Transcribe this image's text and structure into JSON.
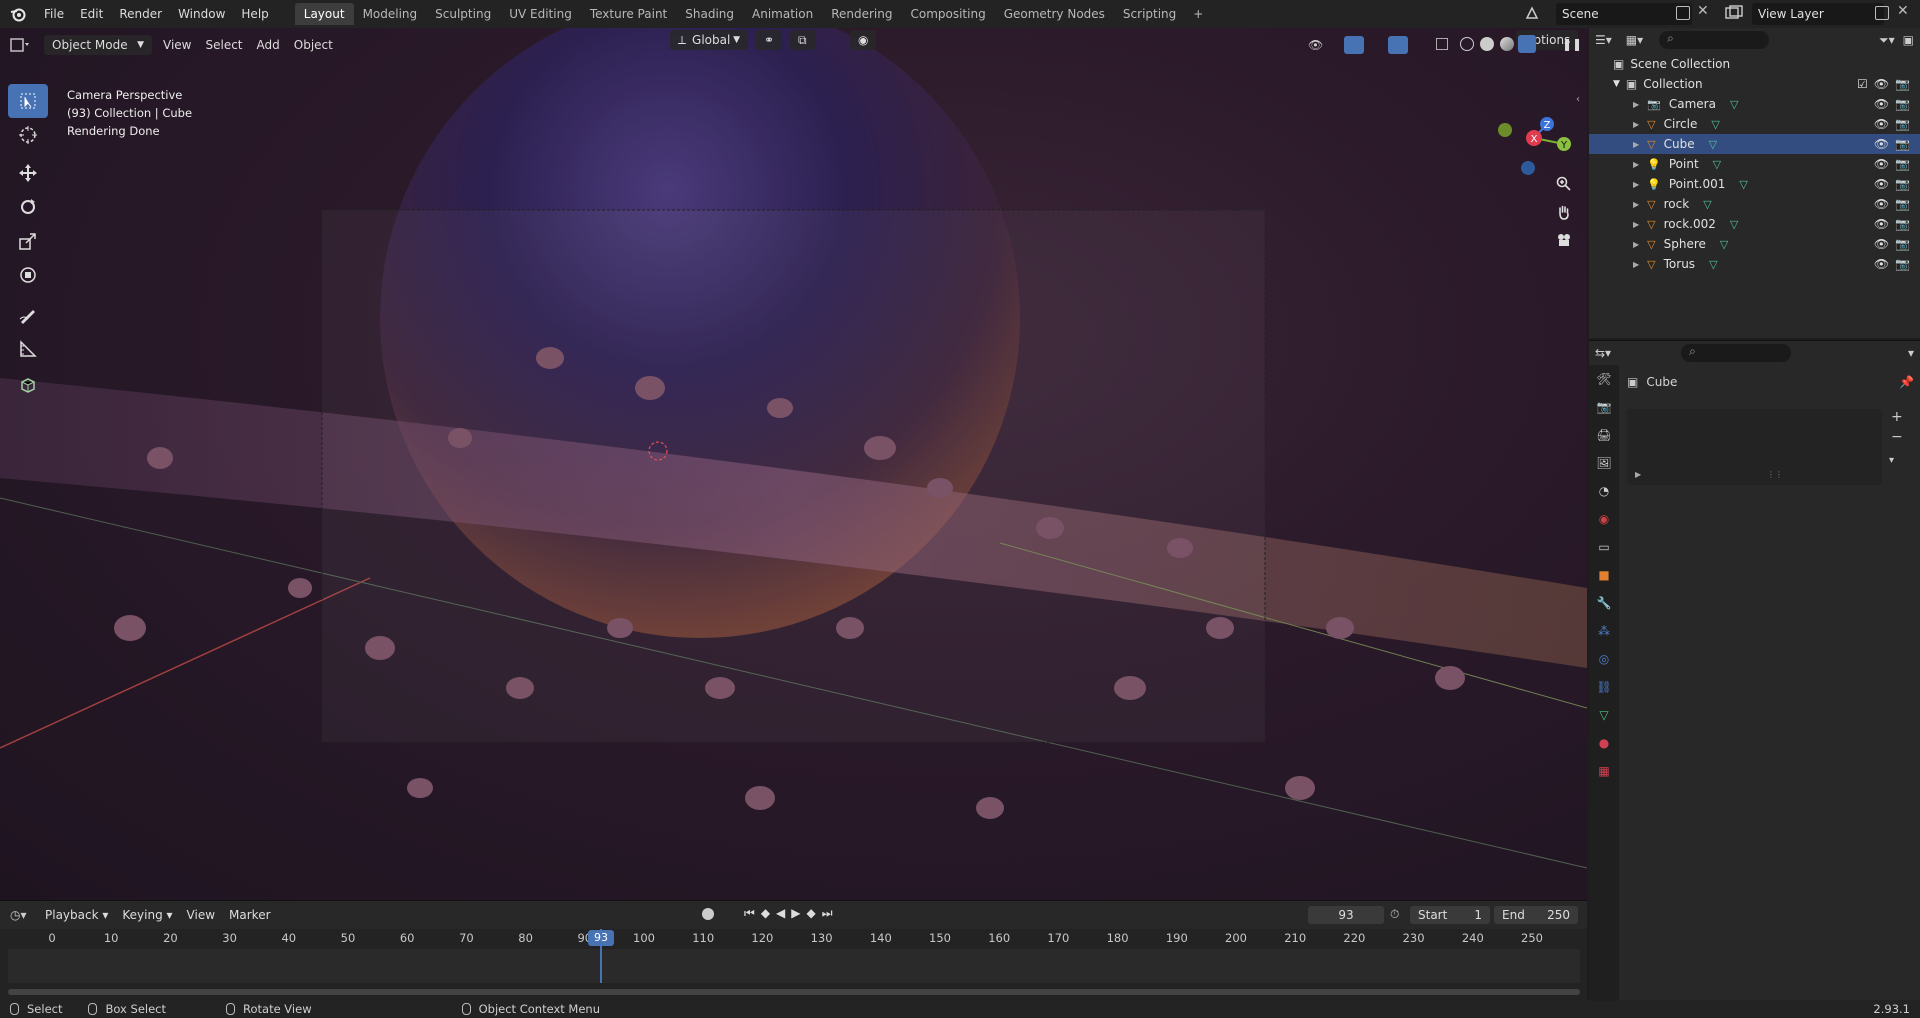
{
  "topbar": {
    "menus": [
      "File",
      "Edit",
      "Render",
      "Window",
      "Help"
    ],
    "workspaces": [
      "Layout",
      "Modeling",
      "Sculpting",
      "UV Editing",
      "Texture Paint",
      "Shading",
      "Animation",
      "Rendering",
      "Compositing",
      "Geometry Nodes",
      "Scripting"
    ],
    "add_workspace": "+",
    "scene": "Scene",
    "view_layer": "View Layer"
  },
  "viewport": {
    "mode": "Object Mode",
    "menus": [
      "View",
      "Select",
      "Add",
      "Object"
    ],
    "orientation": "Global",
    "options": "Options",
    "info": [
      "Camera Perspective",
      "(93) Collection | Cube",
      "Rendering Done"
    ],
    "gizmo": {
      "x": "X",
      "y": "Y",
      "z": "Z"
    }
  },
  "timeline": {
    "playback": "Playback",
    "keying": "Keying",
    "view": "View",
    "marker": "Marker",
    "current_frame": "93",
    "start_label": "Start",
    "start": "1",
    "end_label": "End",
    "end": "250",
    "ticks": [
      "0",
      "10",
      "20",
      "30",
      "40",
      "50",
      "60",
      "70",
      "80",
      "90",
      "100",
      "110",
      "120",
      "130",
      "140",
      "150",
      "160",
      "170",
      "180",
      "190",
      "200",
      "210",
      "220",
      "230",
      "240",
      "250"
    ]
  },
  "statusbar": {
    "select": "Select",
    "box_select": "Box Select",
    "rotate_view": "Rotate View",
    "context_menu": "Object Context Menu",
    "version": "2.93.1"
  },
  "outliner": {
    "scene_collection": "Scene Collection",
    "collection": "Collection",
    "items": [
      {
        "name": "Camera",
        "icon": "camera-icon",
        "selected": false
      },
      {
        "name": "Circle",
        "icon": "mesh-icon",
        "selected": false
      },
      {
        "name": "Cube",
        "icon": "mesh-icon",
        "selected": true
      },
      {
        "name": "Point",
        "icon": "light-icon",
        "selected": false
      },
      {
        "name": "Point.001",
        "icon": "light-icon",
        "selected": false
      },
      {
        "name": "rock",
        "icon": "mesh-icon",
        "selected": false
      },
      {
        "name": "rock.002",
        "icon": "mesh-icon",
        "selected": false
      },
      {
        "name": "Sphere",
        "icon": "mesh-icon",
        "selected": false
      },
      {
        "name": "Torus",
        "icon": "mesh-icon",
        "selected": false
      }
    ]
  },
  "properties": {
    "object_name": "Cube"
  },
  "colors": {
    "accent": "#4772b3",
    "selected_row": "#334d80",
    "playhead": "#4772b3"
  }
}
